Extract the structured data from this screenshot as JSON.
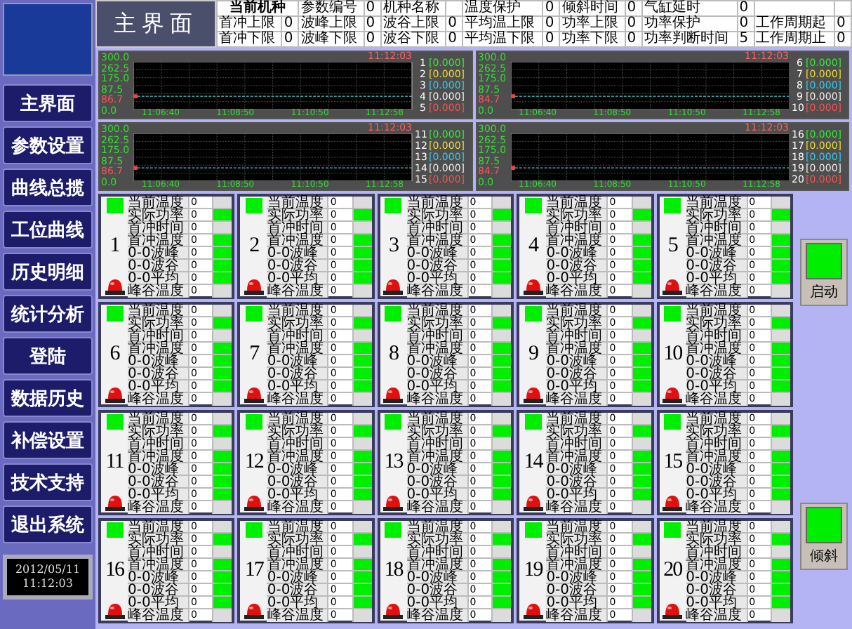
{
  "title": "主界面",
  "menu": [
    {
      "label": "主界面"
    },
    {
      "label": "参数设置"
    },
    {
      "label": "曲线总揽"
    },
    {
      "label": "工位曲线"
    },
    {
      "label": "历史明细"
    },
    {
      "label": "统计分析"
    },
    {
      "label": "登陆"
    },
    {
      "label": "数据历史"
    },
    {
      "label": "补偿设置"
    },
    {
      "label": "技术支持"
    },
    {
      "label": "退出系统"
    }
  ],
  "clock": {
    "date": "2012/05/11",
    "time": "11:12:03"
  },
  "params": [
    [
      {
        "kind": "heading",
        "label": "当前机种"
      },
      {
        "kind": "field",
        "label": "参数编号",
        "value": "0"
      },
      {
        "kind": "field",
        "label": "机种名称"
      },
      {
        "kind": "field",
        "label": "温度保护",
        "value": "0"
      },
      {
        "kind": "field",
        "label": "倾斜时间",
        "value": "0"
      },
      {
        "kind": "field",
        "label": "气缸延时",
        "value": "0"
      },
      {
        "kind": "blank"
      }
    ],
    [
      {
        "kind": "field",
        "label": "首冲上限",
        "value": "0"
      },
      {
        "kind": "field",
        "label": "波峰上限",
        "value": "0"
      },
      {
        "kind": "field",
        "label": "波谷上限",
        "value": "0"
      },
      {
        "kind": "field",
        "label": "平均温上限",
        "value": "0"
      },
      {
        "kind": "field",
        "label": "功率上限",
        "value": "0"
      },
      {
        "kind": "field",
        "label": "功率保护",
        "value": "0"
      },
      {
        "kind": "field",
        "label": "工作周期起",
        "value": "0"
      }
    ],
    [
      {
        "kind": "field",
        "label": "首冲下限",
        "value": "0"
      },
      {
        "kind": "field",
        "label": "波峰下限",
        "value": "0"
      },
      {
        "kind": "field",
        "label": "波谷下限",
        "value": "0"
      },
      {
        "kind": "field",
        "label": "平均温下限",
        "value": "0"
      },
      {
        "kind": "field",
        "label": "功率下限",
        "value": "0"
      },
      {
        "kind": "field",
        "label": "功率判断时间",
        "value": "5"
      },
      {
        "kind": "field",
        "label": "工作周期止",
        "value": "0"
      }
    ]
  ],
  "charts": [
    {
      "time": "11:12:03",
      "y_labels": [
        {
          "text": "300.0",
          "color": "#33dd33"
        },
        {
          "text": "262.5",
          "color": "#33dd33"
        },
        {
          "text": "175.0",
          "color": "#33dd33"
        },
        {
          "text": "87.5",
          "color": "#33dd33"
        },
        {
          "text": "86.7",
          "color": "#ff5050"
        },
        {
          "text": "0.0",
          "color": "#33dd33"
        }
      ],
      "x_labels": [
        "11:06:40",
        "11:08:50",
        "11:10:50",
        "11:12:58"
      ],
      "channels": [
        {
          "number": "1",
          "reading": "[0.000]",
          "color": "#33ee33"
        },
        {
          "number": "2",
          "reading": "[0.000]",
          "color": "#eedd33"
        },
        {
          "number": "3",
          "reading": "[0.000]",
          "color": "#33ccee"
        },
        {
          "number": "4",
          "reading": "[0.000]",
          "color": "#eeeeee"
        },
        {
          "number": "5",
          "reading": "[0.000]",
          "color": "#ff5050"
        }
      ]
    },
    {
      "time": "11:12:03",
      "y_labels": [
        {
          "text": "300.0",
          "color": "#33dd33"
        },
        {
          "text": "262.5",
          "color": "#33dd33"
        },
        {
          "text": "175.0",
          "color": "#33dd33"
        },
        {
          "text": "87.5",
          "color": "#33dd33"
        },
        {
          "text": "84.7",
          "color": "#ff5050"
        },
        {
          "text": "0.0",
          "color": "#33dd33"
        }
      ],
      "x_labels": [
        "11:06:40",
        "11:08:50",
        "11:10:50",
        "11:12:58"
      ],
      "channels": [
        {
          "number": "6",
          "reading": "[0.000]",
          "color": "#33ee33"
        },
        {
          "number": "7",
          "reading": "[0.000]",
          "color": "#eedd33"
        },
        {
          "number": "8",
          "reading": "[0.000]",
          "color": "#33ccee"
        },
        {
          "number": "9",
          "reading": "[0.000]",
          "color": "#eeeeee"
        },
        {
          "number": "10",
          "reading": "[0.000]",
          "color": "#ff5050"
        }
      ]
    },
    {
      "time": "11:12:03",
      "y_labels": [
        {
          "text": "300.0",
          "color": "#33dd33"
        },
        {
          "text": "262.5",
          "color": "#33dd33"
        },
        {
          "text": "175.0",
          "color": "#33dd33"
        },
        {
          "text": "87.5",
          "color": "#33dd33"
        },
        {
          "text": "86.7",
          "color": "#ff5050"
        },
        {
          "text": "0.0",
          "color": "#33dd33"
        }
      ],
      "x_labels": [
        "11:06:40",
        "11:08:50",
        "11:10:50",
        "11:12:58"
      ],
      "channels": [
        {
          "number": "11",
          "reading": "[0.000]",
          "color": "#33ee33"
        },
        {
          "number": "12",
          "reading": "[0.000]",
          "color": "#eedd33"
        },
        {
          "number": "13",
          "reading": "[0.000]",
          "color": "#33ccee"
        },
        {
          "number": "14",
          "reading": "[0.000]",
          "color": "#eeeeee"
        },
        {
          "number": "15",
          "reading": "[0.000]",
          "color": "#ff5050"
        }
      ]
    },
    {
      "time": "11:12:03",
      "y_labels": [
        {
          "text": "300.0",
          "color": "#33dd33"
        },
        {
          "text": "262.5",
          "color": "#33dd33"
        },
        {
          "text": "175.0",
          "color": "#33dd33"
        },
        {
          "text": "87.5",
          "color": "#33dd33"
        },
        {
          "text": "84.7",
          "color": "#ff5050"
        },
        {
          "text": "0.0",
          "color": "#33dd33"
        }
      ],
      "x_labels": [
        "11:06:40",
        "11:08:50",
        "11:10:50",
        "11:12:58"
      ],
      "channels": [
        {
          "number": "16",
          "reading": "[0.000]",
          "color": "#33ee33"
        },
        {
          "number": "17",
          "reading": "[0.000]",
          "color": "#eedd33"
        },
        {
          "number": "18",
          "reading": "[0.000]",
          "color": "#33ccee"
        },
        {
          "number": "19",
          "reading": "[0.000]",
          "color": "#eeeeee"
        },
        {
          "number": "20",
          "reading": "[0.000]",
          "color": "#ff5050"
        }
      ]
    }
  ],
  "stations": [
    {
      "number": "1",
      "running": true,
      "alarm": true,
      "labels": [
        "当前温度",
        "实际功率",
        "首冲时间",
        "首冲温度",
        "0-0波峰",
        "0-0波谷",
        "0-0平均",
        "峰谷温度"
      ],
      "values": [
        "0",
        "0",
        "0",
        "0",
        "0",
        "0",
        "0",
        "0"
      ],
      "lamps": [
        false,
        true,
        false,
        true,
        true,
        true,
        true,
        false
      ]
    },
    {
      "number": "2",
      "running": true,
      "alarm": true,
      "labels": [
        "当前温度",
        "实际功率",
        "首冲时间",
        "首冲温度",
        "0-0波峰",
        "0-0波谷",
        "0-0平均",
        "峰谷温度"
      ],
      "values": [
        "0",
        "0",
        "0",
        "0",
        "0",
        "0",
        "0",
        "0"
      ],
      "lamps": [
        false,
        true,
        false,
        true,
        true,
        true,
        true,
        false
      ]
    },
    {
      "number": "3",
      "running": true,
      "alarm": true,
      "labels": [
        "当前温度",
        "实际功率",
        "首冲时间",
        "首冲温度",
        "0-0波峰",
        "0-0波谷",
        "0-0平均",
        "峰谷温度"
      ],
      "values": [
        "0",
        "0",
        "0",
        "0",
        "0",
        "0",
        "0",
        "0"
      ],
      "lamps": [
        false,
        true,
        false,
        true,
        true,
        true,
        true,
        false
      ]
    },
    {
      "number": "4",
      "running": true,
      "alarm": true,
      "labels": [
        "当前温度",
        "实际功率",
        "首冲时间",
        "首冲温度",
        "0-0波峰",
        "0-0波谷",
        "0-0平均",
        "峰谷温度"
      ],
      "values": [
        "0",
        "0",
        "0",
        "0",
        "0",
        "0",
        "0",
        "0"
      ],
      "lamps": [
        false,
        true,
        false,
        true,
        true,
        true,
        true,
        false
      ]
    },
    {
      "number": "5",
      "running": true,
      "alarm": true,
      "labels": [
        "当前温度",
        "实际功率",
        "首冲时间",
        "首冲温度",
        "0-0波峰",
        "0-0波谷",
        "0-0平均",
        "峰谷温度"
      ],
      "values": [
        "0",
        "0",
        "0",
        "0",
        "0",
        "0",
        "0",
        "0"
      ],
      "lamps": [
        false,
        true,
        false,
        true,
        true,
        true,
        true,
        false
      ]
    },
    {
      "number": "6",
      "running": true,
      "alarm": true,
      "labels": [
        "当前温度",
        "实际功率",
        "首冲时间",
        "首冲温度",
        "0-0波峰",
        "0-0波谷",
        "0-0平均",
        "峰谷温度"
      ],
      "values": [
        "0",
        "0",
        "0",
        "0",
        "0",
        "0",
        "0",
        "0"
      ],
      "lamps": [
        false,
        true,
        false,
        true,
        true,
        true,
        true,
        false
      ]
    },
    {
      "number": "7",
      "running": true,
      "alarm": true,
      "labels": [
        "当前温度",
        "实际功率",
        "首冲时间",
        "首冲温度",
        "0-0波峰",
        "0-0波谷",
        "0-0平均",
        "峰谷温度"
      ],
      "values": [
        "0",
        "0",
        "0",
        "0",
        "0",
        "0",
        "0",
        "0"
      ],
      "lamps": [
        false,
        true,
        false,
        true,
        true,
        true,
        true,
        false
      ]
    },
    {
      "number": "8",
      "running": true,
      "alarm": true,
      "labels": [
        "当前温度",
        "实际功率",
        "首冲时间",
        "首冲温度",
        "0-0波峰",
        "0-0波谷",
        "0-0平均",
        "峰谷温度"
      ],
      "values": [
        "0",
        "0",
        "0",
        "0",
        "0",
        "0",
        "0",
        "0"
      ],
      "lamps": [
        false,
        true,
        false,
        true,
        true,
        true,
        true,
        false
      ]
    },
    {
      "number": "9",
      "running": true,
      "alarm": true,
      "labels": [
        "当前温度",
        "实际功率",
        "首冲时间",
        "首冲温度",
        "0-0波峰",
        "0-0波谷",
        "0-0平均",
        "峰谷温度"
      ],
      "values": [
        "0",
        "0",
        "0",
        "0",
        "0",
        "0",
        "0",
        "0"
      ],
      "lamps": [
        false,
        true,
        false,
        true,
        true,
        true,
        true,
        false
      ]
    },
    {
      "number": "10",
      "running": true,
      "alarm": true,
      "labels": [
        "当前温度",
        "实际功率",
        "首冲时间",
        "首冲温度",
        "0-0波峰",
        "0-0波谷",
        "0-0平均",
        "峰谷温度"
      ],
      "values": [
        "0",
        "0",
        "0",
        "0",
        "0",
        "0",
        "0",
        "0"
      ],
      "lamps": [
        false,
        true,
        false,
        true,
        true,
        true,
        true,
        false
      ]
    },
    {
      "number": "11",
      "running": true,
      "alarm": true,
      "labels": [
        "当前温度",
        "实际功率",
        "首冲时间",
        "首冲温度",
        "0-0波峰",
        "0-0波谷",
        "0-0平均",
        "峰谷温度"
      ],
      "values": [
        "0",
        "0",
        "0",
        "0",
        "0",
        "0",
        "0",
        "0"
      ],
      "lamps": [
        false,
        true,
        false,
        true,
        true,
        true,
        true,
        false
      ]
    },
    {
      "number": "12",
      "running": true,
      "alarm": true,
      "labels": [
        "当前温度",
        "实际功率",
        "首冲时间",
        "首冲温度",
        "0-0波峰",
        "0-0波谷",
        "0-0平均",
        "峰谷温度"
      ],
      "values": [
        "0",
        "0",
        "0",
        "0",
        "0",
        "0",
        "0",
        "0"
      ],
      "lamps": [
        false,
        true,
        false,
        true,
        true,
        true,
        true,
        false
      ]
    },
    {
      "number": "13",
      "running": true,
      "alarm": true,
      "labels": [
        "当前温度",
        "实际功率",
        "首冲时间",
        "首冲温度",
        "0-0波峰",
        "0-0波谷",
        "0-0平均",
        "峰谷温度"
      ],
      "values": [
        "0",
        "0",
        "0",
        "0",
        "0",
        "0",
        "0",
        "0"
      ],
      "lamps": [
        false,
        true,
        false,
        true,
        true,
        true,
        true,
        false
      ]
    },
    {
      "number": "14",
      "running": true,
      "alarm": true,
      "labels": [
        "当前温度",
        "实际功率",
        "首冲时间",
        "首冲温度",
        "0-0波峰",
        "0-0波谷",
        "0-0平均",
        "峰谷温度"
      ],
      "values": [
        "0",
        "0",
        "0",
        "0",
        "0",
        "0",
        "0",
        "0"
      ],
      "lamps": [
        false,
        true,
        false,
        true,
        true,
        true,
        true,
        false
      ]
    },
    {
      "number": "15",
      "running": true,
      "alarm": true,
      "labels": [
        "当前温度",
        "实际功率",
        "首冲时间",
        "首冲温度",
        "0-0波峰",
        "0-0波谷",
        "0-0平均",
        "峰谷温度"
      ],
      "values": [
        "0",
        "0",
        "0",
        "0",
        "0",
        "0",
        "0",
        "0"
      ],
      "lamps": [
        false,
        true,
        false,
        true,
        true,
        true,
        true,
        false
      ]
    },
    {
      "number": "16",
      "running": true,
      "alarm": true,
      "labels": [
        "当前温度",
        "实际功率",
        "首冲时间",
        "首冲温度",
        "0-0波峰",
        "0-0波谷",
        "0-0平均",
        "峰谷温度"
      ],
      "values": [
        "0",
        "0",
        "0",
        "0",
        "0",
        "0",
        "0",
        "0"
      ],
      "lamps": [
        false,
        true,
        false,
        true,
        true,
        true,
        true,
        false
      ]
    },
    {
      "number": "17",
      "running": true,
      "alarm": true,
      "labels": [
        "当前温度",
        "实际功率",
        "首冲时间",
        "首冲温度",
        "0-0波峰",
        "0-0波谷",
        "0-0平均",
        "峰谷温度"
      ],
      "values": [
        "0",
        "0",
        "0",
        "0",
        "0",
        "0",
        "0",
        "0"
      ],
      "lamps": [
        false,
        true,
        false,
        true,
        true,
        true,
        true,
        false
      ]
    },
    {
      "number": "18",
      "running": true,
      "alarm": true,
      "labels": [
        "当前温度",
        "实际功率",
        "首冲时间",
        "首冲温度",
        "0-0波峰",
        "0-0波谷",
        "0-0平均",
        "峰谷温度"
      ],
      "values": [
        "0",
        "0",
        "0",
        "0",
        "0",
        "0",
        "0",
        "0"
      ],
      "lamps": [
        false,
        true,
        false,
        true,
        true,
        true,
        true,
        false
      ]
    },
    {
      "number": "19",
      "running": true,
      "alarm": true,
      "labels": [
        "当前温度",
        "实际功率",
        "首冲时间",
        "首冲温度",
        "0-0波峰",
        "0-0波谷",
        "0-0平均",
        "峰谷温度"
      ],
      "values": [
        "0",
        "0",
        "0",
        "0",
        "0",
        "0",
        "0",
        "0"
      ],
      "lamps": [
        false,
        true,
        false,
        true,
        true,
        true,
        true,
        false
      ]
    },
    {
      "number": "20",
      "running": true,
      "alarm": true,
      "labels": [
        "当前温度",
        "实际功率",
        "首冲时间",
        "首冲温度",
        "0-0波峰",
        "0-0波谷",
        "0-0平均",
        "峰谷温度"
      ],
      "values": [
        "0",
        "0",
        "0",
        "0",
        "0",
        "0",
        "0",
        "0"
      ],
      "lamps": [
        false,
        true,
        false,
        true,
        true,
        true,
        true,
        false
      ]
    }
  ],
  "actions": [
    {
      "label": "启动",
      "on": true
    },
    {
      "label": "倾斜",
      "on": true
    }
  ]
}
